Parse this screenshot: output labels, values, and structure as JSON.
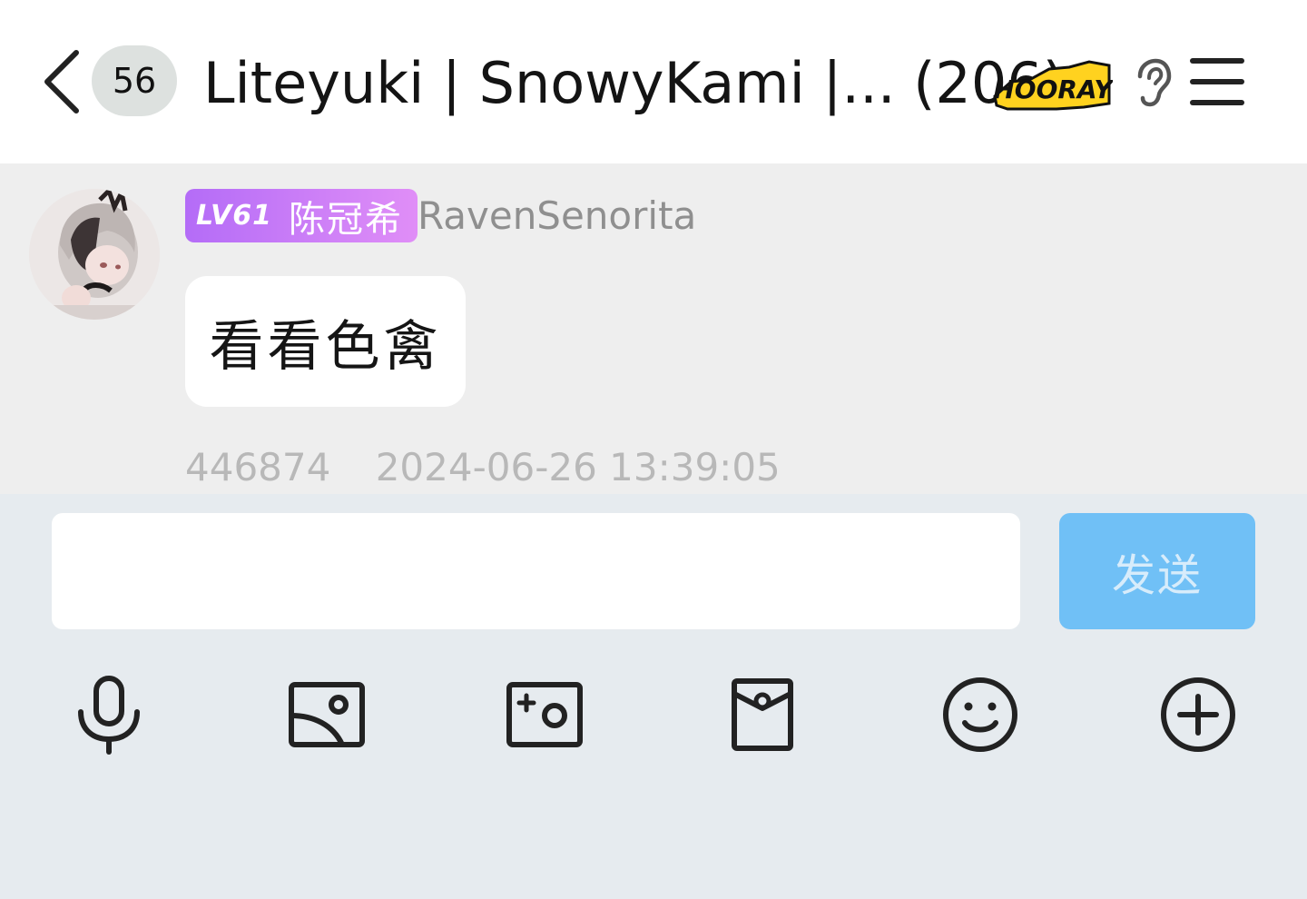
{
  "header": {
    "unread_count": "56",
    "title": "Liteyuki | SnowyKami |... (206)",
    "hooray_badge": "HOORAY",
    "icons": [
      "chevron-left-icon",
      "ear-icon",
      "menu-icon"
    ]
  },
  "message": {
    "level": "LV61",
    "member_title": "陈冠希",
    "sender": "RavenSenorita",
    "text": "看看色禽",
    "user_id": "446874",
    "timestamp": "2024-06-26 13:39:05"
  },
  "composer": {
    "input_value": "",
    "send_label": "发送"
  },
  "toolbar": {
    "items": [
      "microphone-icon",
      "image-icon",
      "camera-icon",
      "red-packet-icon",
      "emoji-icon",
      "plus-icon"
    ]
  },
  "colors": {
    "send_button": "#70c0f6",
    "badge_gradient_start": "#b46cf7",
    "badge_gradient_end": "#e08ef7",
    "chat_background": "#eeeeee",
    "toolbar_background": "#e6ebef"
  }
}
